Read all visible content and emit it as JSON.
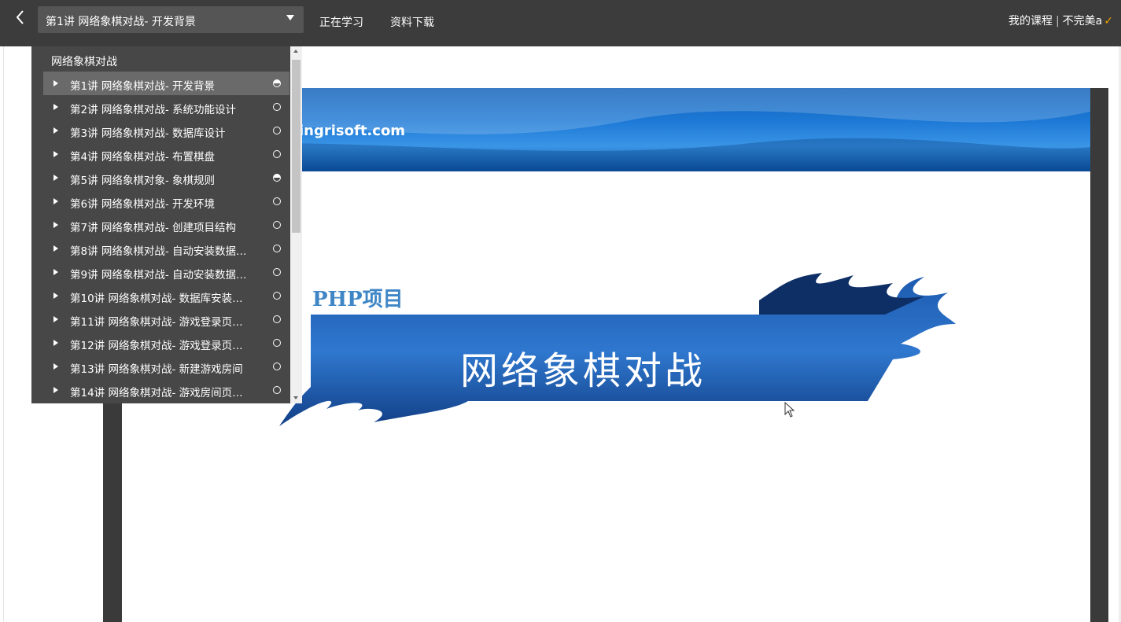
{
  "header": {
    "current_lesson": "第1讲 网络象棋对战- 开发背景",
    "nav": [
      "正在学习",
      "资料下载"
    ],
    "my_courses": "我的课程",
    "user": "不完美a"
  },
  "menu": {
    "group_title": "网络象棋对战",
    "items": [
      {
        "label": "第1讲 网络象棋对战- 开发背景",
        "status": "half"
      },
      {
        "label": "第2讲 网络象棋对战- 系统功能设计",
        "status": "empty"
      },
      {
        "label": "第3讲 网络象棋对战- 数据库设计",
        "status": "empty"
      },
      {
        "label": "第4讲 网络象棋对战- 布置棋盘",
        "status": "empty"
      },
      {
        "label": "第5讲 网络象棋对象- 象棋规则",
        "status": "half"
      },
      {
        "label": "第6讲 网络象棋对战- 开发环境",
        "status": "empty"
      },
      {
        "label": "第7讲 网络象棋对战- 创建项目结构",
        "status": "empty"
      },
      {
        "label": "第8讲 网络象棋对战- 自动安装数据…",
        "status": "empty"
      },
      {
        "label": "第9讲 网络象棋对战- 自动安装数据…",
        "status": "empty"
      },
      {
        "label": "第10讲 网络象棋对战- 数据库安装…",
        "status": "empty"
      },
      {
        "label": "第11讲 网络象棋对战- 游戏登录页…",
        "status": "empty"
      },
      {
        "label": "第12讲 网络象棋对战- 游戏登录页…",
        "status": "empty"
      },
      {
        "label": "第13讲 网络象棋对战- 新建游戏房间",
        "status": "empty"
      },
      {
        "label": "第14讲 网络象棋对战- 游戏房间页…",
        "status": "empty"
      }
    ]
  },
  "slide": {
    "banner_text": "ingrisoft.com",
    "project_label": "PHP项目",
    "title": "网络象棋对战"
  },
  "colors": {
    "topbar": "#3c3c3c",
    "menu_bg": "#474747",
    "menu_active": "#6a6a6a",
    "flag_blue": "#1b4f9a",
    "user_mark": "#f0a000"
  }
}
